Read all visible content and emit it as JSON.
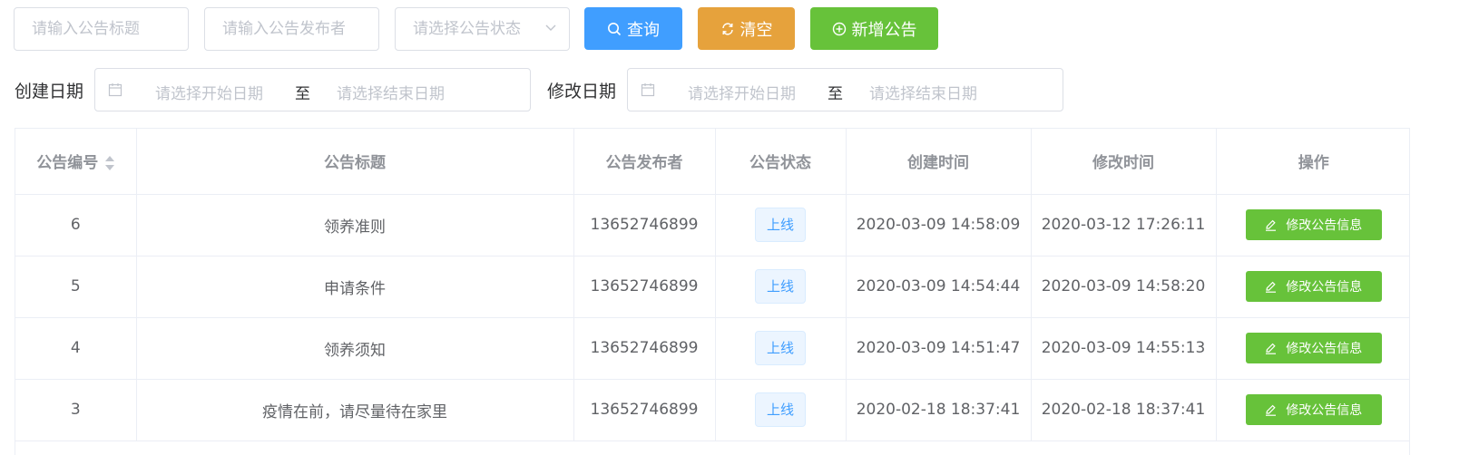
{
  "filters": {
    "title_placeholder": "请输入公告标题",
    "publisher_placeholder": "请输入公告发布者",
    "status_placeholder": "请选择公告状态",
    "search_label": "查询",
    "clear_label": "清空",
    "add_label": "新增公告"
  },
  "date_filters": {
    "created_label": "创建日期",
    "modified_label": "修改日期",
    "start_placeholder": "请选择开始日期",
    "range_separator": "至",
    "end_placeholder": "请选择结束日期"
  },
  "table": {
    "columns": [
      "公告编号",
      "公告标题",
      "公告发布者",
      "公告状态",
      "创建时间",
      "修改时间",
      "操作"
    ],
    "action_label": "修改公告信息",
    "rows": [
      {
        "id": "6",
        "title": "领养准则",
        "publisher": "13652746899",
        "status": "上线",
        "created": "2020-03-09 14:58:09",
        "modified": "2020-03-12 17:26:11"
      },
      {
        "id": "5",
        "title": "申请条件",
        "publisher": "13652746899",
        "status": "上线",
        "created": "2020-03-09 14:54:44",
        "modified": "2020-03-09 14:58:20"
      },
      {
        "id": "4",
        "title": "领养须知",
        "publisher": "13652746899",
        "status": "上线",
        "created": "2020-03-09 14:51:47",
        "modified": "2020-03-09 14:55:13"
      },
      {
        "id": "3",
        "title": "疫情在前，请尽量待在家里",
        "publisher": "13652746899",
        "status": "上线",
        "created": "2020-02-18 18:37:41",
        "modified": "2020-02-18 18:37:41"
      }
    ]
  },
  "colors": {
    "primary": "#409eff",
    "warning": "#e6a23c",
    "success": "#67c23a"
  }
}
